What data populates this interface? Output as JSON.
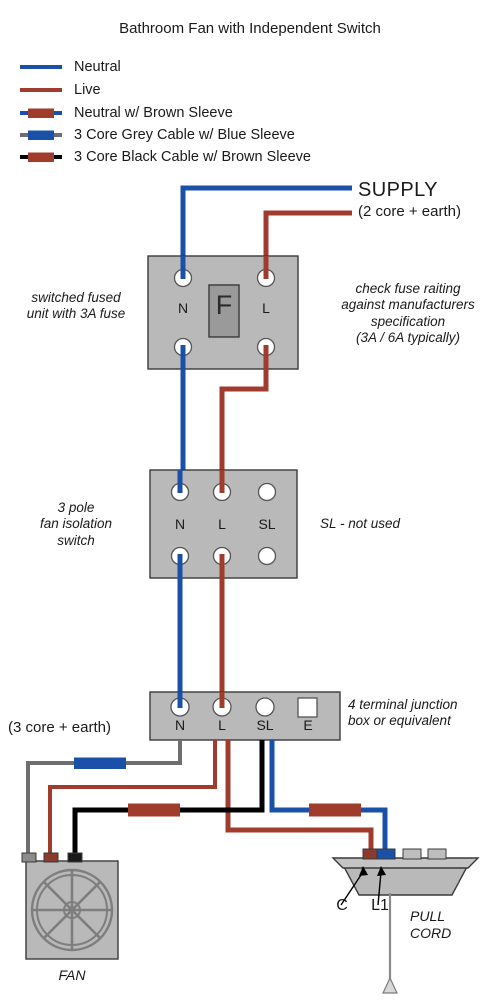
{
  "title": "Bathroom Fan with Independent Switch",
  "colors": {
    "neutral_blue": "#1a50a8",
    "live_brown": "#a03c2c",
    "sleeve_brown": "#a03c2c",
    "grey_cable": "#6e6e6e",
    "black_cable": "#000000",
    "body_grey": "#b9b9b9",
    "fuse_grey": "#9a9a9a",
    "outline": "#3a3a3a"
  },
  "legend": {
    "items": [
      {
        "label": "Neutral",
        "style": "solid-blue"
      },
      {
        "label": "Live",
        "style": "solid-brown"
      },
      {
        "label": "Neutral w/ Brown Sleeve",
        "style": "blue-with-brown-sleeve"
      },
      {
        "label": "3 Core Grey Cable w/ Blue Sleeve",
        "style": "grey-with-blue-sleeve"
      },
      {
        "label": "3 Core Black Cable w/ Brown Sleeve",
        "style": "black-with-brown-sleeve"
      }
    ]
  },
  "supply": {
    "heading": "SUPPLY",
    "subtitle": "(2 core + earth)"
  },
  "fused_unit": {
    "caption": "switched fused\nunit with 3A fuse",
    "fuse_label": "F",
    "terminals": [
      "N",
      "L"
    ],
    "note": "check fuse raiting\nagainst manufacturers\nspecification\n(3A / 6A typically)"
  },
  "isolation_switch": {
    "caption": "3 pole\nfan isolation\nswitch",
    "terminals": [
      "N",
      "L",
      "SL"
    ],
    "note": "SL - not used"
  },
  "junction_box": {
    "terminals": [
      "N",
      "L",
      "SL",
      "E"
    ],
    "note": "4 terminal junction\nbox or equivalent",
    "cable_label": "(3 core + earth)"
  },
  "fan": {
    "caption": "FAN",
    "blade_count": 8
  },
  "pull_cord": {
    "caption": "PULL\nCORD",
    "terminals": [
      "C",
      "L1"
    ]
  }
}
